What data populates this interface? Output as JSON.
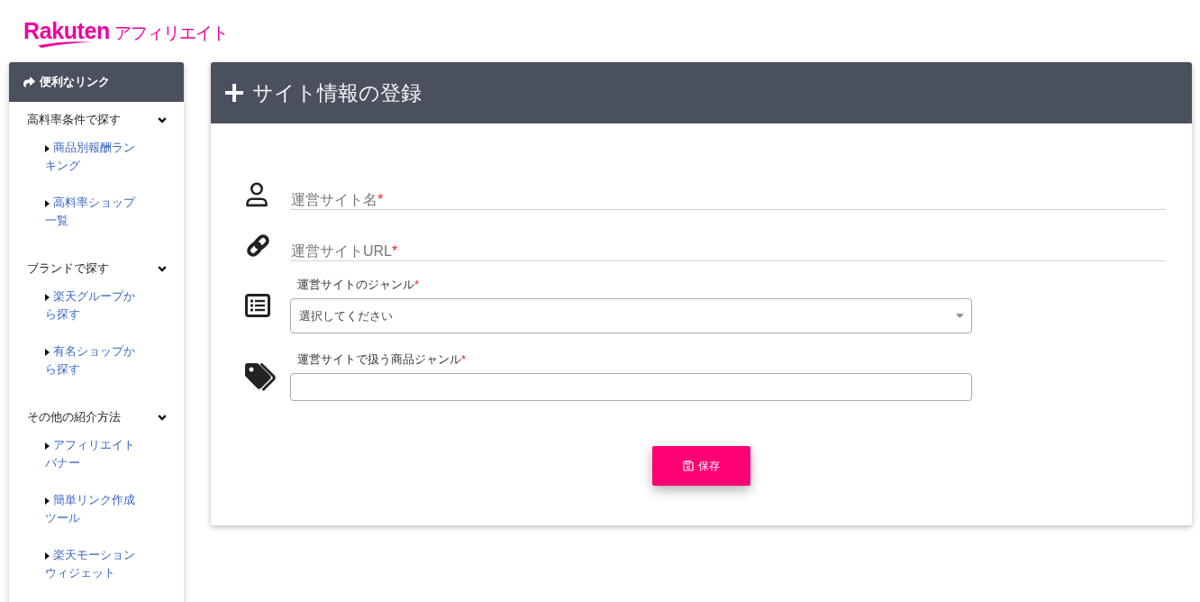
{
  "logo": {
    "brand": "Rakuten",
    "product": "アフィリエイト"
  },
  "sidebar": {
    "title": "便利なリンク",
    "sections": [
      {
        "label": "高料率条件で探す",
        "expanded": true,
        "links": [
          "商品別報酬ランキング",
          "高料率ショップ一覧"
        ]
      },
      {
        "label": "ブランドで探す",
        "expanded": true,
        "links": [
          "楽天グループから探す",
          "有名ショップから探す"
        ]
      },
      {
        "label": "その他の紹介方法",
        "expanded": true,
        "links": [
          "アフィリエイトバナー",
          "簡単リンク作成ツール",
          "楽天モーションウィジェット"
        ]
      }
    ]
  },
  "form": {
    "title": "サイト情報の登録",
    "fields": [
      {
        "kind": "line",
        "label": "運営サイト名",
        "required_mark": "*"
      },
      {
        "kind": "line",
        "label": "運営サイトURL",
        "required_mark": "*"
      },
      {
        "kind": "select",
        "label": "運営サイトのジャンル",
        "required_mark": "*",
        "value": "選択してください"
      },
      {
        "kind": "box",
        "label": "運営サイトで扱う商品ジャンル",
        "required_mark": "*"
      }
    ],
    "save_button": "保存"
  }
}
